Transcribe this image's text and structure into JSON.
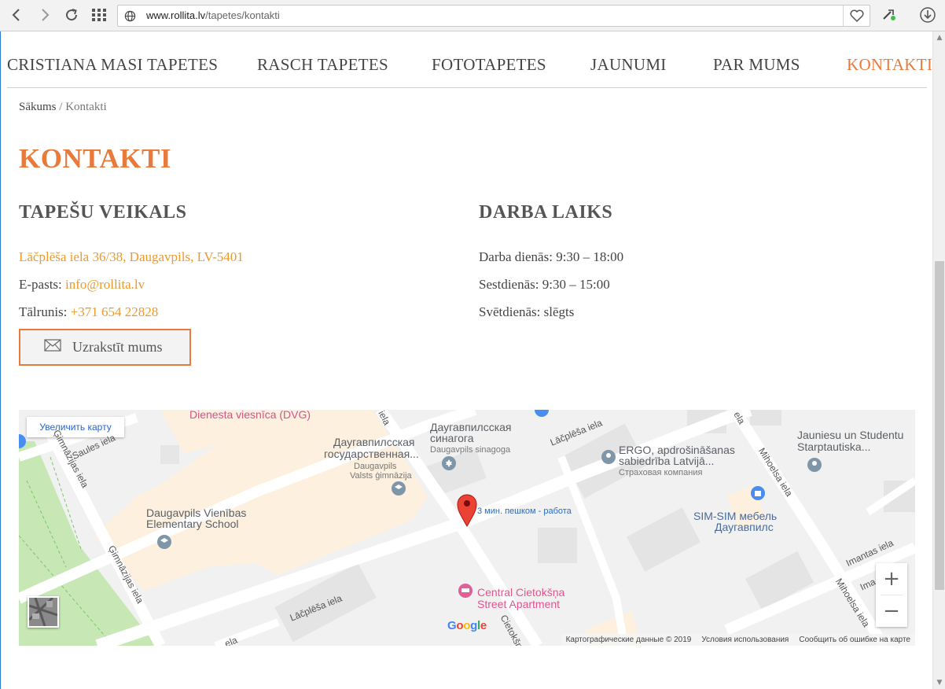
{
  "browser": {
    "url_host": "www.rollita.lv",
    "url_path": "/tapetes/kontakti"
  },
  "nav": {
    "items": [
      {
        "label": "CRISTIANA MASI TAPETES"
      },
      {
        "label": "RASCH TAPETES"
      },
      {
        "label": "FOTOTAPETES"
      },
      {
        "label": "JAUNUMI"
      },
      {
        "label": "PAR MUMS"
      },
      {
        "label": "KONTAKTI",
        "active": true
      }
    ]
  },
  "breadcrumb": {
    "home": "Sākums",
    "separator": "/",
    "current": "Kontakti"
  },
  "page_title": "KONTAKTI",
  "store": {
    "title": "TAPEŠU VEIKALS",
    "address": "Lāčplēša iela 36/38, Daugavpils, LV-5401",
    "email_label": "E-pasts:",
    "email": "info@rollita.lv",
    "phone_label": "Tālrunis:",
    "phone": "+371 654 22828",
    "button_label": "Uzrakstīt mums"
  },
  "hours": {
    "title": "DARBA LAIKS",
    "weekdays_label": "Darba dienās:",
    "weekdays": "9:30 – 18:00",
    "saturday_label": "Sestdienās:",
    "saturday": "9:30 – 15:00",
    "sunday_label": "Svētdienās:",
    "sunday": "slēgts"
  },
  "map": {
    "enlarge_label": "Увеличить карту",
    "labels": {
      "dvg": "Dienesta viesnīca (DVG)",
      "gymnasium_ru_1": "Даугавпилсская",
      "gymnasium_ru_2": "государственная...",
      "gymnasium_lv_1": "Daugavpils",
      "gymnasium_lv_2": "Valsts ģimnāzija",
      "synagogue_ru_1": "Даугавпилсская",
      "synagogue_ru_2": "синагога",
      "synagogue_lv": "Daugavpils sinagoga",
      "ergo_1": "ERGO, apdrošināšanas",
      "ergo_2": "sabiedrība Latvijā...",
      "ergo_3": "Страховая компания",
      "youth_1": "Jauniesu un Studentu",
      "youth_2": "Starptautiska...",
      "simsim_1": "SIM-SIM мебель",
      "simsim_2": "Даугавпилс",
      "school_1": "Daugavpils Vienības",
      "school_2": "Elementary School",
      "route": "3 мин. пешком - работа",
      "apartment_1": "Central Cietokšņa",
      "apartment_2": "Street Apartment",
      "saules": "Saules iela",
      "gimnazijas_1": "Ģimnāzijas iela",
      "gimnazijas_2": "Ģimnāzijas iela",
      "lacplesa_1": "Lāčplēša iela",
      "lacplesa_2": "Lāčplēša iela",
      "miholsa_1": "Mihoelsa iela",
      "miholsa_2": "Mihoelsa iela",
      "imantas_1": "Imantas iela",
      "imantas_2": "Ima",
      "cietoksna": "Cietokšņ",
      "iela_a": "iela",
      "iela_b": "ela",
      "iela_c": "ela"
    },
    "google": "Google",
    "footer": {
      "data": "Картографические данные © 2019",
      "terms": "Условия использования",
      "report": "Сообщить об ошибке на карте"
    }
  },
  "colors": {
    "accent": "#e87a3b",
    "link": "#ed9a2c"
  }
}
